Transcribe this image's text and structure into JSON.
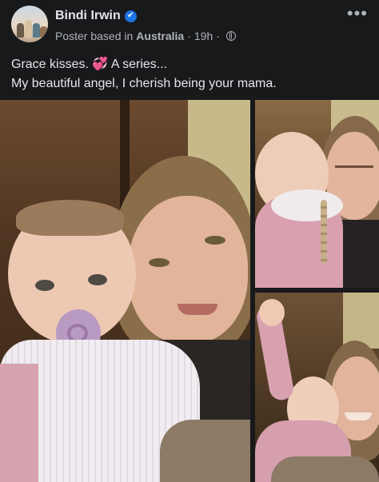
{
  "post": {
    "author": "Bindi Irwin",
    "verified": "✔",
    "meta_prefix": "Poster based in",
    "location": "Australia",
    "separator": "·",
    "time": "19h",
    "more": "•••",
    "caption_line1_a": "Grace kisses.",
    "caption_emoji": "💞",
    "caption_line1_b": "A series...",
    "caption_line2": "My beautiful angel, I cherish being your mama."
  },
  "icons": {
    "verified": "verified-badge-icon",
    "privacy": "globe-icon",
    "more": "more-options-icon"
  },
  "colors": {
    "background": "#18191a",
    "primary_text": "#e4e6eb",
    "secondary_text": "#b0b3b8",
    "verified_blue": "#1b74e4",
    "heart_pink": "#ff3fa4"
  }
}
